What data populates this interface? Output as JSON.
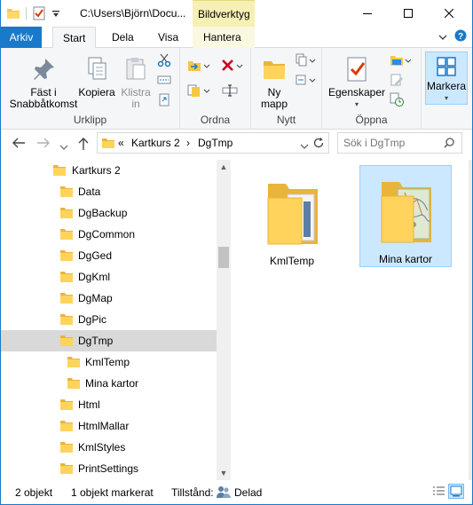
{
  "titlebar": {
    "path": "C:\\Users\\Björn\\Docu...",
    "context_tab_group": "Bildverktyg",
    "minimize": "—",
    "maximize": "☐",
    "close": "✕"
  },
  "tabs": [
    {
      "label": "Arkiv"
    },
    {
      "label": "Start"
    },
    {
      "label": "Dela"
    },
    {
      "label": "Visa"
    },
    {
      "label": "Hantera"
    }
  ],
  "ribbon": {
    "groups": [
      {
        "label": "Urklipp"
      },
      {
        "label": "Ordna"
      },
      {
        "label": "Nytt"
      },
      {
        "label": "Öppna"
      }
    ],
    "pin_label": "Fäst i Snabbåtkomst",
    "pin_line1": "Fäst i",
    "pin_line2": "Snabbåtkomst",
    "copy_label": "Kopiera",
    "paste_line1": "Klistra",
    "paste_line2": "in",
    "new_folder_line1": "Ny",
    "new_folder_line2": "mapp",
    "properties_label": "Egenskaper",
    "select_label": "Markera",
    "colors": {
      "accent": "#1979ca",
      "ribbon_bg": "#f5f6f7",
      "context": "#f7f0b5"
    }
  },
  "address": {
    "overflow": "«",
    "crumbs": [
      "Kartkurs 2",
      "DgTmp"
    ],
    "separator": "›"
  },
  "search": {
    "placeholder": "Sök i DgTmp"
  },
  "tree": {
    "root": "Kartkurs 2",
    "items": [
      {
        "label": "Data"
      },
      {
        "label": "DgBackup"
      },
      {
        "label": "DgCommon"
      },
      {
        "label": "DgGed"
      },
      {
        "label": "DgKml"
      },
      {
        "label": "DgMap"
      },
      {
        "label": "DgPic"
      },
      {
        "label": "DgTmp"
      },
      {
        "label": "KmlTemp"
      },
      {
        "label": "Mina kartor"
      },
      {
        "label": "Html"
      },
      {
        "label": "HtmlMallar"
      },
      {
        "label": "KmlStyles"
      },
      {
        "label": "PrintSettings"
      }
    ],
    "selected": "DgTmp"
  },
  "content": {
    "items": [
      {
        "name": "KmlTemp",
        "selected": false
      },
      {
        "name": "Mina kartor",
        "selected": true
      }
    ]
  },
  "status": {
    "count": "2 objekt",
    "selected": "1 objekt markerat",
    "state_label": "Tillstånd:",
    "state_value": "Delad"
  }
}
